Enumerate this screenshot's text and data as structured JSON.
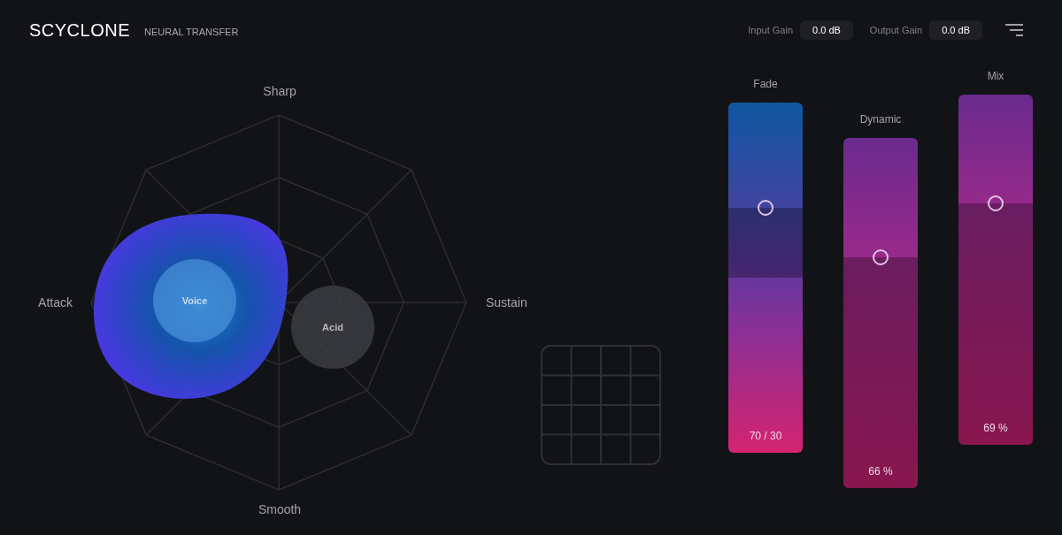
{
  "header": {
    "title": "SCYCLONE",
    "subtitle": "NEURAL TRANSFER",
    "input_gain": {
      "label": "Input Gain",
      "value": "0.0 dB"
    },
    "output_gain": {
      "label": "Output Gain",
      "value": "0.0 dB"
    }
  },
  "radar": {
    "axes": [
      {
        "label": "Sharp",
        "kind": "top"
      },
      {
        "label": "Sustain",
        "kind": "right"
      },
      {
        "label": "Smooth",
        "kind": "bottom"
      },
      {
        "label": "Attack",
        "kind": "left"
      }
    ],
    "nodes": [
      {
        "label": "Voice",
        "selected": true
      },
      {
        "label": "Acid",
        "selected": false
      }
    ]
  },
  "faders": [
    {
      "label": "Fade",
      "reading": "70 / 30",
      "level": 0.7,
      "kind": "crossfade"
    },
    {
      "label": "Dynamic",
      "reading": "66 %",
      "level": 0.66,
      "kind": "single"
    },
    {
      "label": "Mix",
      "reading": "69 %",
      "level": 0.69,
      "kind": "single"
    }
  ]
}
